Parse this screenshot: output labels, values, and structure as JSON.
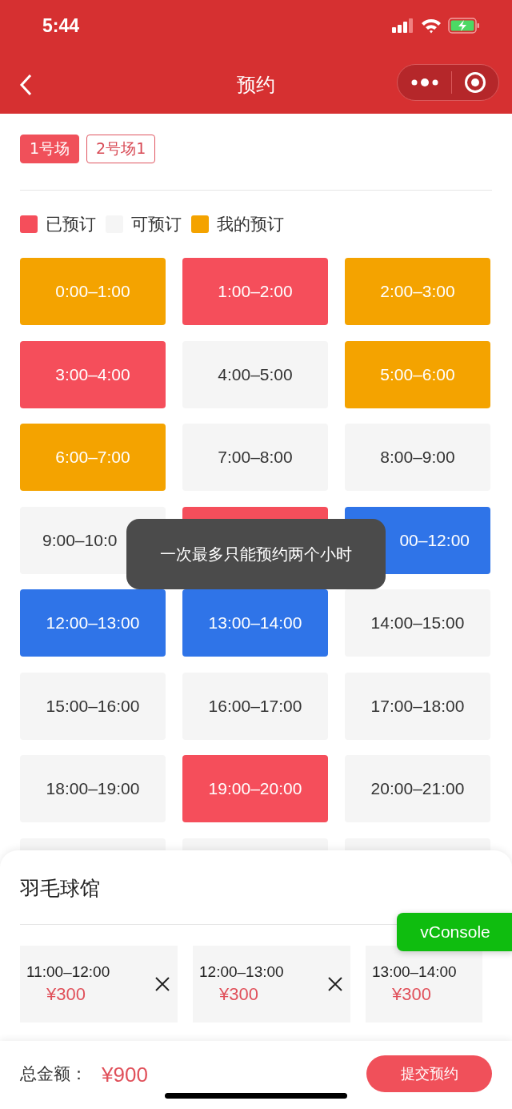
{
  "status_bar": {
    "time": "5:44"
  },
  "nav": {
    "title": "预约"
  },
  "courts": [
    {
      "label": "1号场",
      "selected": true
    },
    {
      "label": "2号场1",
      "selected": false
    }
  ],
  "legend": [
    {
      "color": "#f54e5b",
      "label": "已预订"
    },
    {
      "color": "#f5f5f5",
      "label": "可预订"
    },
    {
      "color": "#f4a300",
      "label": "我的预订"
    }
  ],
  "slots": [
    {
      "kind": "full",
      "label": "0:00–1:00",
      "color": "#f4a300"
    },
    {
      "kind": "full",
      "label": "1:00–2:00",
      "color": "#f54e5b"
    },
    {
      "kind": "full",
      "label": "2:00–3:00",
      "color": "#f4a300"
    },
    {
      "kind": "full",
      "label": "3:00–4:00",
      "color": "#f54e5b"
    },
    {
      "kind": "full",
      "label": "4:00–5:00",
      "color": "#f5f5f5"
    },
    {
      "kind": "full",
      "label": "5:00–6:00",
      "color": "#f4a300"
    },
    {
      "kind": "full",
      "label": "6:00–7:00",
      "color": "#f4a300"
    },
    {
      "kind": "full",
      "label": "7:00–8:00",
      "color": "#f5f5f5"
    },
    {
      "kind": "full",
      "label": "8:00–9:00",
      "color": "#f5f5f5"
    },
    {
      "kind": "cut_end",
      "label": "9:00–10:0",
      "color": "#f5f5f5"
    },
    {
      "kind": "blank",
      "color": "#f54e5b"
    },
    {
      "kind": "cut_start",
      "label": "00–12:00",
      "color": "#2f74e8"
    },
    {
      "kind": "full",
      "label": "12:00–13:00",
      "color": "#2f74e8"
    },
    {
      "kind": "full",
      "label": "13:00–14:00",
      "color": "#2f74e8"
    },
    {
      "kind": "full",
      "label": "14:00–15:00",
      "color": "#f5f5f5"
    },
    {
      "kind": "full",
      "label": "15:00–16:00",
      "color": "#f5f5f5"
    },
    {
      "kind": "full",
      "label": "16:00–17:00",
      "color": "#f5f5f5"
    },
    {
      "kind": "full",
      "label": "17:00–18:00",
      "color": "#f5f5f5"
    },
    {
      "kind": "full",
      "label": "18:00–19:00",
      "color": "#f5f5f5"
    },
    {
      "kind": "full",
      "label": "19:00–20:00",
      "color": "#f54e5b"
    },
    {
      "kind": "full",
      "label": "20:00–21:00",
      "color": "#f5f5f5"
    },
    {
      "kind": "blank",
      "color": "#f5f5f5"
    },
    {
      "kind": "blank",
      "color": "#f5f5f5"
    },
    {
      "kind": "blank",
      "color": "#f5f5f5"
    }
  ],
  "toast": "一次最多只能预约两个小时",
  "sheet": {
    "title": "羽毛球馆",
    "picks": [
      {
        "time": "11:00–12:00",
        "price": "¥300",
        "removable": true
      },
      {
        "time": "12:00–13:00",
        "price": "¥300",
        "removable": true
      },
      {
        "time": "13:00–14:00",
        "price": "¥300",
        "removable": false
      }
    ]
  },
  "vconsole": "vConsole",
  "footer": {
    "total_label": "总金额：",
    "total": "¥900",
    "submit": "提交预约"
  }
}
